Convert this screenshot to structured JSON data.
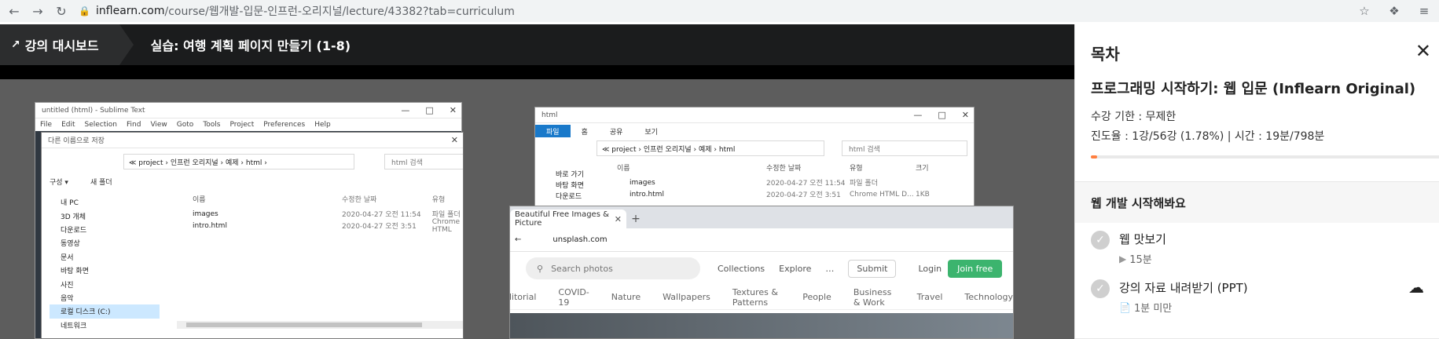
{
  "browser": {
    "url_host": "inflearn.com",
    "url_path": "/course/웹개발-입문-인프런-오리지널/lecture/43382?tab=curriculum"
  },
  "header": {
    "dashboard_label": "강의 대시보드",
    "lecture_title": "실습: 여행 계획 페이지 만들기 (1-8)"
  },
  "video": {
    "sublime": {
      "title": "untitled (html) - Sublime Text",
      "menu": [
        "File",
        "Edit",
        "Selection",
        "Find",
        "View",
        "Goto",
        "Tools",
        "Project",
        "Preferences",
        "Help"
      ]
    },
    "save_dialog": {
      "title": "다른 이름으로 저장",
      "address": "≪ project › 인프런 오리지널 › 예제 › html ›",
      "search_placeholder": "html 검색",
      "toolbar": [
        "구성 ▾",
        "새 폴더"
      ],
      "sidebar": [
        "내 PC",
        "3D 개체",
        "다운로드",
        "동영상",
        "문서",
        "바탕 화면",
        "사진",
        "음악",
        "로컬 디스크 (C:)",
        "네트워크"
      ],
      "columns": [
        "이름",
        "수정한 날짜",
        "유형"
      ],
      "rows": [
        {
          "name": "images",
          "date": "2020-04-27 오전 11:54",
          "type": "파일 폴더"
        },
        {
          "name": "intro.html",
          "date": "2020-04-27 오전 3:51",
          "type": "Chrome HTML"
        }
      ]
    },
    "explorer": {
      "title": "html",
      "ribbon": [
        "파일",
        "홈",
        "공유",
        "보기"
      ],
      "address": "≪ project › 인프런 오리지널 › 예제 › html",
      "search_placeholder": "html 검색",
      "sidebar": [
        "바로 가기",
        "바탕 화면",
        "다운로드"
      ],
      "columns": [
        "이름",
        "수정한 날짜",
        "유형",
        "크기"
      ],
      "rows": [
        {
          "name": "images",
          "date": "2020-04-27 오전 11:54",
          "type": "파일 폴더",
          "size": ""
        },
        {
          "name": "intro.html",
          "date": "2020-04-27 오전 3:51",
          "type": "Chrome HTML D...",
          "size": "1KB"
        }
      ]
    },
    "chrome": {
      "tab_title": "Beautiful Free Images & Picture",
      "url": "unsplash.com",
      "search_placeholder": "Search photos",
      "nav": [
        "Collections",
        "Explore"
      ],
      "submit": "Submit",
      "login": "Login",
      "join": "Join free",
      "categories": [
        "Editorial",
        "COVID-19",
        "Nature",
        "Wallpapers",
        "Textures & Patterns",
        "People",
        "Business & Work",
        "Travel",
        "Technology"
      ]
    }
  },
  "panel": {
    "title": "목차",
    "course_name": "프로그래밍 시작하기: 웹 입문 (Inflearn Original)",
    "period": "수강 기한 : 무제한",
    "progress_text": "진도율 : 1강/56강 (1.78%) | 시간 : 19분/798분",
    "progress_percent": 1.78,
    "section_title": "웹 개발 시작해봐요",
    "lessons": [
      {
        "name": "웹 맛보기",
        "meta": "15분",
        "meta_icon": "play-icon"
      },
      {
        "name": "강의 자료 내려받기 (PPT)",
        "meta": "1분 미만",
        "meta_icon": "document-icon"
      }
    ]
  }
}
